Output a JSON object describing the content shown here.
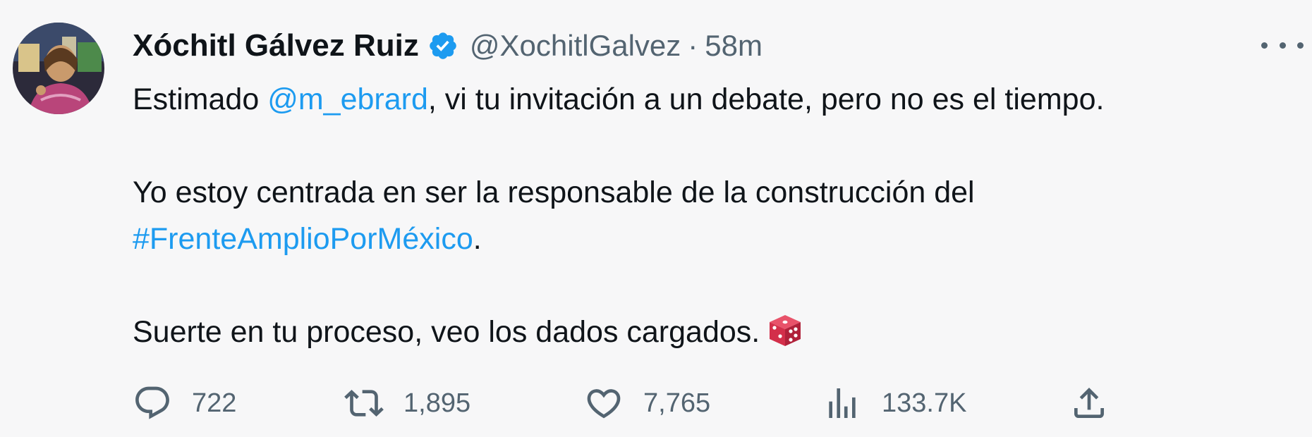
{
  "tweet": {
    "author_name": "Xóchitl Gálvez Ruiz",
    "handle": "@XochitlGalvez",
    "separator": "·",
    "time": "58m",
    "text": {
      "p1_before": "Estimado ",
      "p1_mention": "@m_ebrard",
      "p1_after": ", vi tu invitación a un debate, pero no es el tiempo.",
      "p2_text": "Yo estoy centrada en ser la responsable de la construcción del ",
      "p2_hashtag": "#FrenteAmplioPorMéxico",
      "p2_after": ".",
      "p3_text": "Suerte en tu proceso, veo los dados cargados."
    },
    "emoji": "game-die",
    "stats": {
      "replies": "722",
      "retweets": "1,895",
      "likes": "7,765",
      "views": "133.7K"
    }
  },
  "colors": {
    "background": "#f7f7f8",
    "text": "#0f1419",
    "secondary": "#536471",
    "link": "#1d9bf0",
    "verified": "#1d9bf0"
  },
  "icons": {
    "verified": "verified-badge-icon",
    "more": "more-options-icon",
    "reply": "reply-icon",
    "retweet": "retweet-icon",
    "like": "like-icon",
    "views": "views-icon",
    "share": "share-icon"
  }
}
